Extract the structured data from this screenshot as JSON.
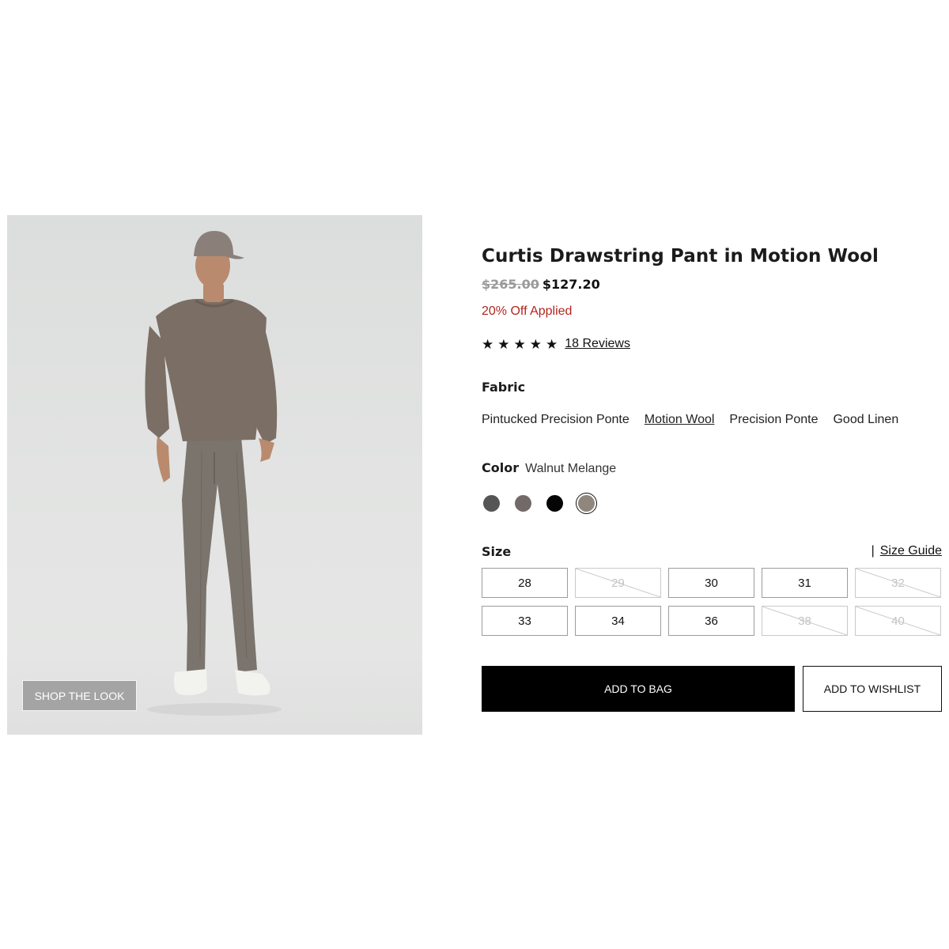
{
  "hero": {
    "shop_look_label": "SHOP THE LOOK",
    "model_colors": {
      "sweater": "#7b6e64",
      "pants": "#7a746d",
      "skin": "#b98a6e",
      "cap": "#8a8079",
      "shoes": "#f2f2ee"
    }
  },
  "product": {
    "title": "Curtis Drawstring Pant in Motion Wool",
    "price_original": "$265.00",
    "price_sale": "$127.20",
    "discount_text": "20% Off Applied",
    "rating_stars": 5,
    "reviews_label": "18 Reviews"
  },
  "fabric": {
    "label": "Fabric",
    "options": [
      {
        "label": "Pintucked Precision Ponte",
        "active": false
      },
      {
        "label": "Motion Wool",
        "active": true
      },
      {
        "label": "Precision Ponte",
        "active": false
      },
      {
        "label": "Good Linen",
        "active": false
      }
    ]
  },
  "color": {
    "label": "Color",
    "selected_name": "Walnut Melange",
    "swatches": [
      {
        "name": "charcoal-swatch",
        "hex": "#555555",
        "selected": false
      },
      {
        "name": "taupe-swatch",
        "hex": "#716a69",
        "selected": false
      },
      {
        "name": "black-swatch",
        "hex": "#050505",
        "selected": false
      },
      {
        "name": "walnut-melange-swatch",
        "hex": "#8f877e",
        "selected": true
      }
    ]
  },
  "size": {
    "label": "Size",
    "guide_label": "Size Guide",
    "options": [
      {
        "label": "28",
        "available": true
      },
      {
        "label": "29",
        "available": false
      },
      {
        "label": "30",
        "available": true
      },
      {
        "label": "31",
        "available": true
      },
      {
        "label": "32",
        "available": false
      },
      {
        "label": "33",
        "available": true
      },
      {
        "label": "34",
        "available": true
      },
      {
        "label": "36",
        "available": true
      },
      {
        "label": "38",
        "available": false
      },
      {
        "label": "40",
        "available": false
      }
    ]
  },
  "actions": {
    "add_to_bag": "ADD TO BAG",
    "add_to_wishlist": "ADD TO WISHLIST"
  }
}
